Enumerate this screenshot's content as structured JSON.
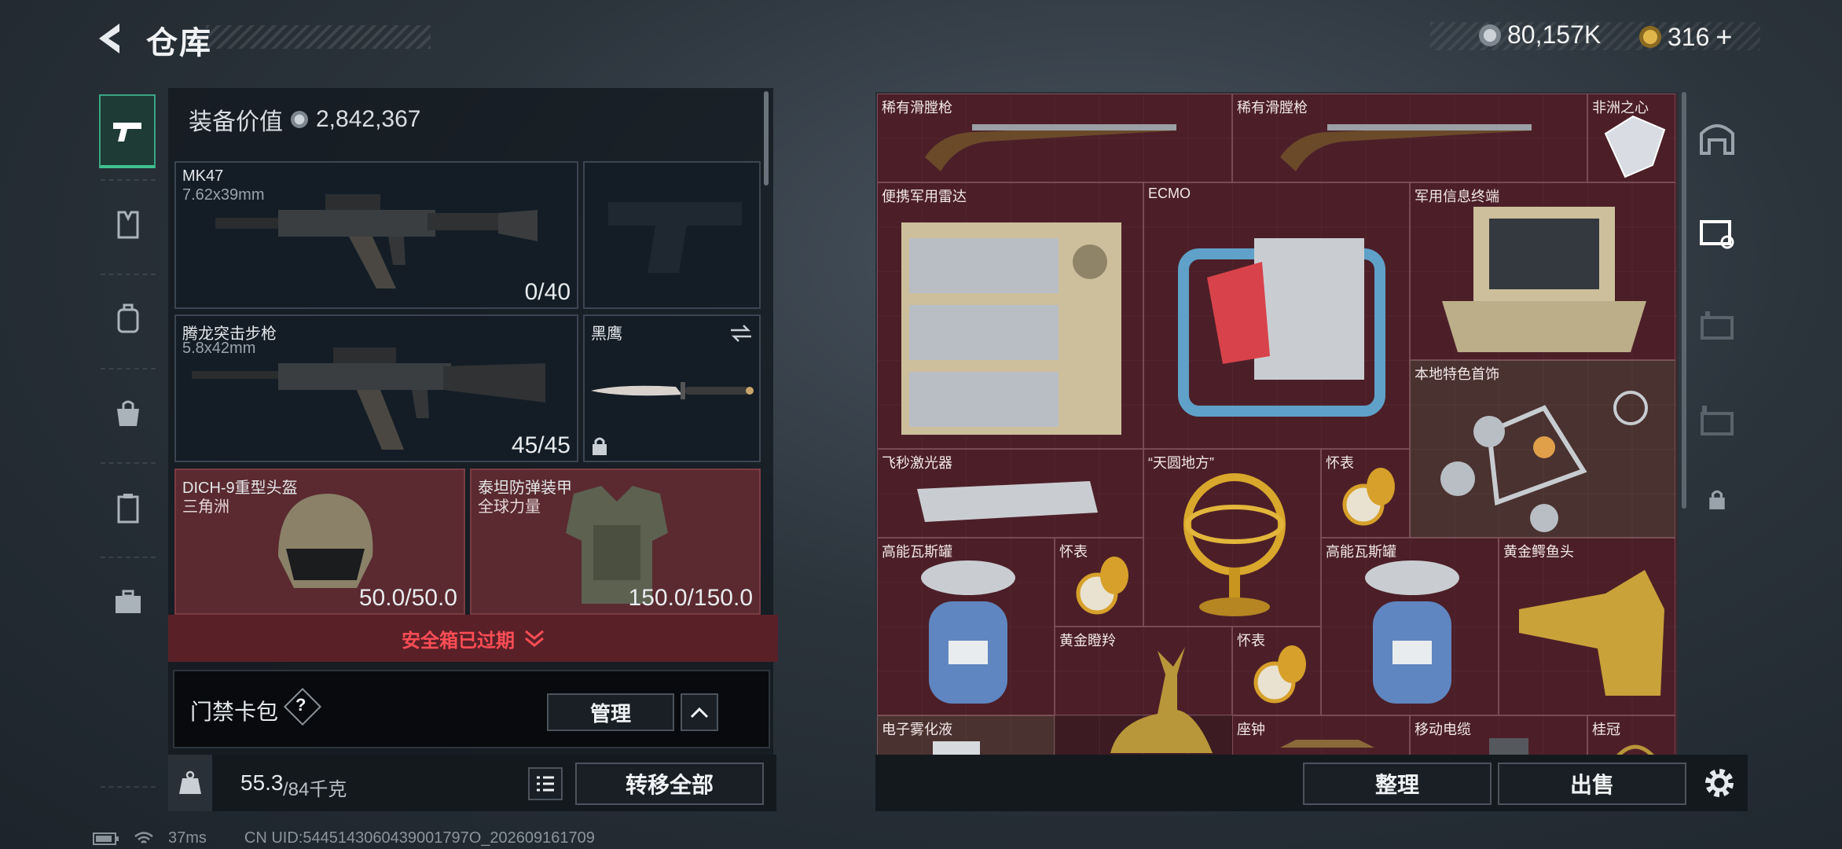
{
  "header": {
    "title": "仓库"
  },
  "currency": {
    "coins": "80,157K",
    "premium": "316",
    "plus": "+"
  },
  "equipment": {
    "value_label": "装备价值",
    "value": "2,842,367",
    "slots": [
      {
        "name": "MK47",
        "sub": "7.62x39mm",
        "count": "0/40"
      },
      {
        "name": "腾龙突击步枪",
        "sub": "5.8x42mm",
        "count": "45/45"
      },
      {
        "name": "黑鹰"
      },
      {
        "name": "DICH-9重型头盔",
        "sub": "三角洲",
        "count": "50.0/50.0"
      },
      {
        "name": "泰坦防弹装甲",
        "sub": "全球力量",
        "count": "150.0/150.0"
      }
    ]
  },
  "safebox": {
    "expired": "安全箱已过期"
  },
  "keycard": {
    "label": "门禁卡包",
    "help": "?",
    "manage": "管理"
  },
  "weight": {
    "current": "55.3",
    "max": "/84千克"
  },
  "actions": {
    "transfer_all": "转移全部",
    "sort": "整理",
    "sell": "出售"
  },
  "storage": {
    "items": [
      {
        "label": "稀有滑膛枪",
        "icon": "musket"
      },
      {
        "label": "稀有滑膛枪",
        "icon": "musket"
      },
      {
        "label": "非洲之心",
        "icon": "diamond"
      },
      {
        "label": "便携军用雷达",
        "icon": "radar"
      },
      {
        "label": "ECMO",
        "icon": "ecmo"
      },
      {
        "label": "军用信息终端",
        "icon": "terminal"
      },
      {
        "label": "本地特色首饰",
        "icon": "jewelry"
      },
      {
        "label": "飞秒激光器",
        "icon": "laser"
      },
      {
        "label": "“天圆地方”",
        "icon": "armillary"
      },
      {
        "label": "怀表",
        "icon": "pocket-watch"
      },
      {
        "label": "高能瓦斯罐",
        "icon": "gas-can"
      },
      {
        "label": "怀表",
        "icon": "pocket-watch"
      },
      {
        "label": "高能瓦斯罐",
        "icon": "gas-can"
      },
      {
        "label": "黄金鳄鱼头",
        "icon": "gold-croc"
      },
      {
        "label": "黄金瞪羚",
        "icon": "gold-gazelle"
      },
      {
        "label": "怀表",
        "icon": "pocket-watch"
      },
      {
        "label": "电子雾化液",
        "icon": "liquid"
      },
      {
        "label": "座钟",
        "icon": "clock"
      },
      {
        "label": "移动电缆",
        "icon": "cable"
      },
      {
        "label": "桂冠",
        "icon": "laurel"
      }
    ]
  },
  "status": {
    "ping": "37ms",
    "uid": "CN UID:5445143060439001797O_202609161709"
  },
  "colors": {
    "accent_green": "#3aa583",
    "expired_red": "#ff4d55",
    "grid_bg": "#3c1b22"
  }
}
